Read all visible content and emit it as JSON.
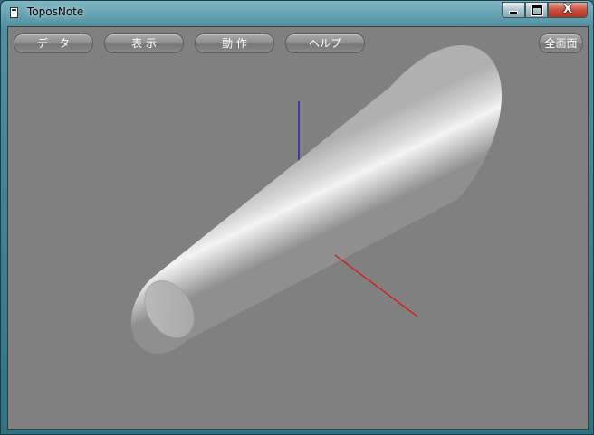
{
  "window": {
    "title": "ToposNote",
    "controls": {
      "minimize": "",
      "maximize": "",
      "close": "X"
    }
  },
  "toolbar": {
    "buttons": [
      "データ",
      "表 示",
      "動 作",
      "ヘルプ"
    ],
    "fullscreen": "全画面"
  },
  "viewport": {
    "background": "#808080",
    "axis_colors": {
      "x": "#e01010",
      "z": "#1010d0"
    }
  }
}
